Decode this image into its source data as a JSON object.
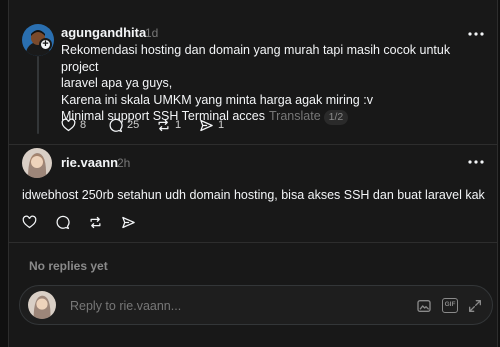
{
  "post": {
    "author": "agungandhita",
    "time": "1d",
    "lines": [
      "Rekomendasi hosting dan domain yang murah tapi masih cocok untuk project",
      "laravel apa ya guys,",
      "Karena ini skala UMKM yang minta harga agak miring :v",
      "Minimal support SSH Terminal acces"
    ],
    "translate_label": "Translate",
    "page_indicator": "1/2",
    "actions": {
      "likes": "8",
      "comments": "25",
      "reposts": "1",
      "shares": "1"
    }
  },
  "reply": {
    "author": "rie.vaann",
    "time": "2h",
    "text": "idwebhost 250rb setahun udh domain hosting, bisa akses SSH dan buat laravel kak"
  },
  "no_replies_label": "No replies yet",
  "composer": {
    "placeholder": "Reply to rie.vaann...",
    "gif_label": "GIF"
  },
  "colors": {
    "background": "#181818",
    "text": "#f3f5f7",
    "muted": "#777777",
    "divider": "#2d2d2d"
  }
}
